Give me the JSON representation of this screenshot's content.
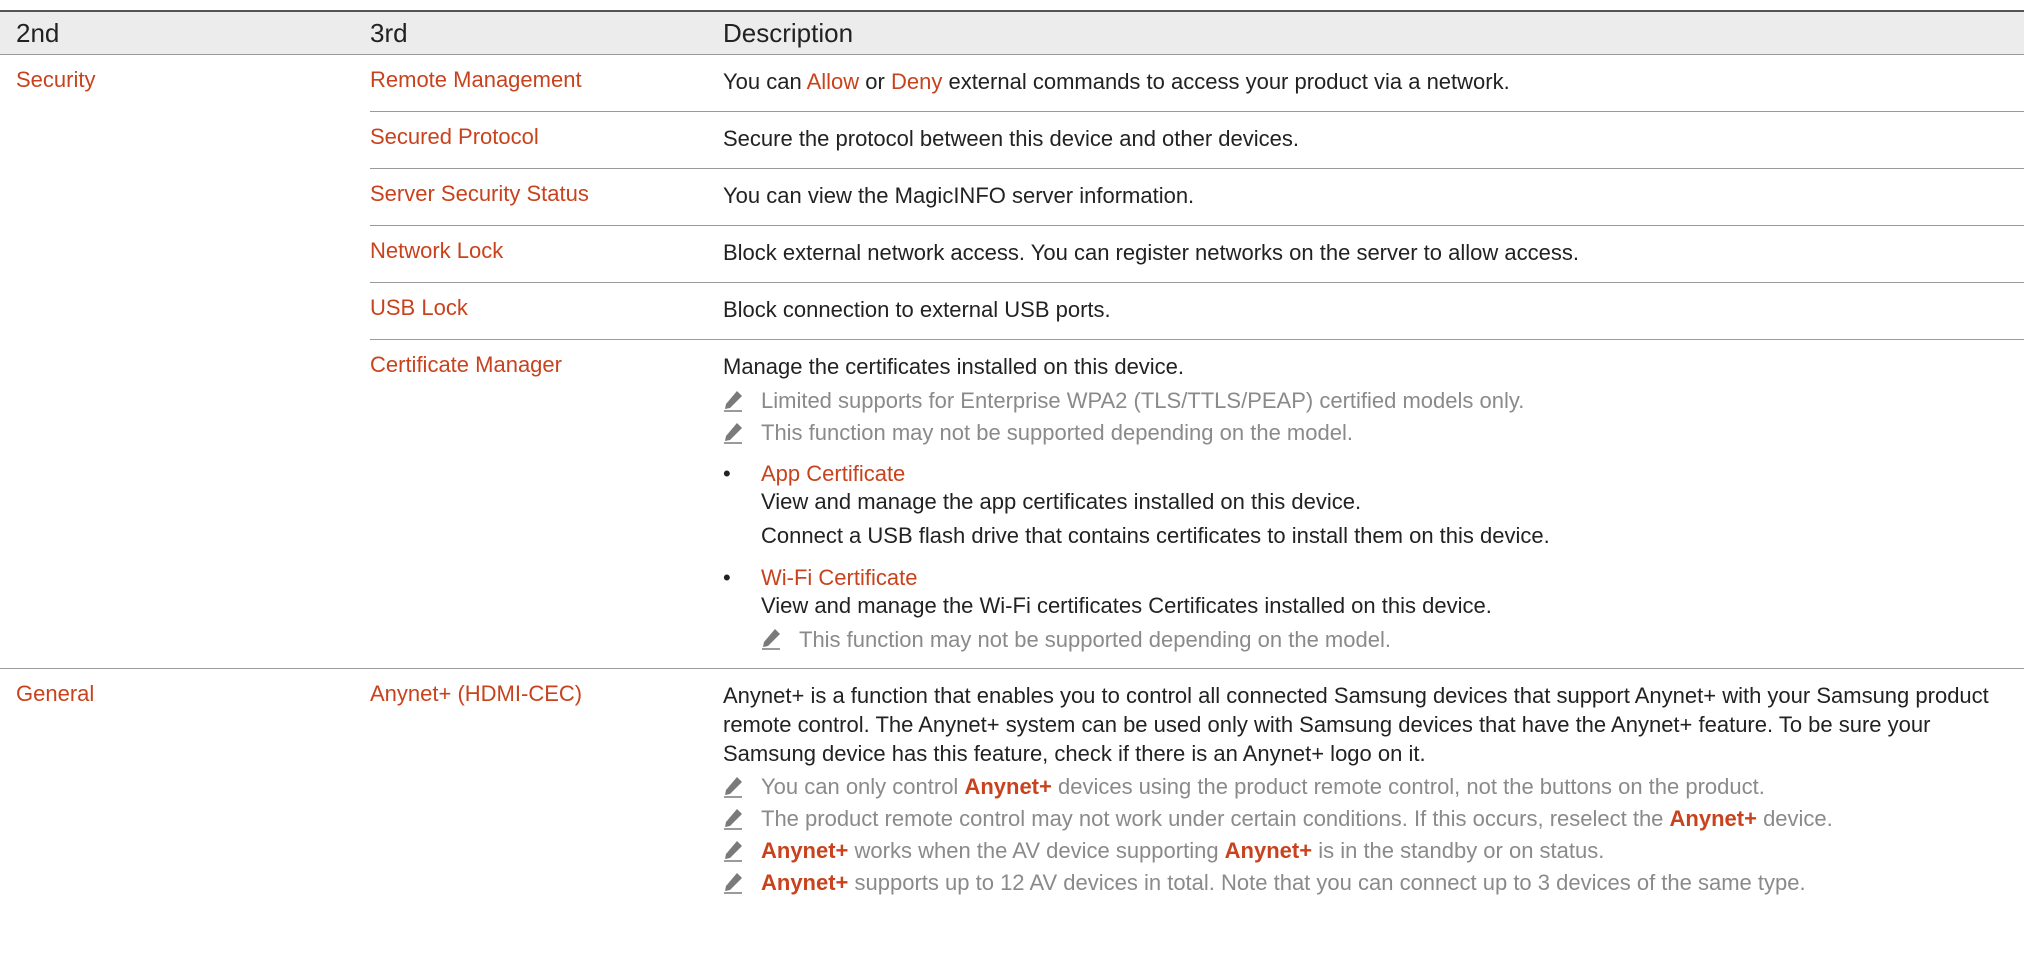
{
  "header": {
    "col1": "2nd",
    "col2": "3rd",
    "col3": "Description"
  },
  "security": {
    "label": "Security",
    "remote_management": {
      "name": "Remote Management",
      "desc_pre": "You can ",
      "allow": "Allow",
      "or": " or ",
      "deny": "Deny",
      "desc_post": " external commands to access your product via a network."
    },
    "secured_protocol": {
      "name": "Secured Protocol",
      "desc": "Secure the protocol between this device and other devices."
    },
    "server_security_status": {
      "name": "Server Security Status",
      "desc": "You can view the MagicINFO server information."
    },
    "network_lock": {
      "name": "Network Lock",
      "desc": "Block external network access. You can register networks on the server to allow access."
    },
    "usb_lock": {
      "name": "USB Lock",
      "desc": "Block connection to external USB ports."
    },
    "certificate_manager": {
      "name": "Certificate Manager",
      "desc": "Manage the certificates installed on this device.",
      "note1": "Limited supports for Enterprise WPA2 (TLS/TTLS/PEAP) certified models only.",
      "note2": "This function may not be supported depending on the model.",
      "bullet_char": "•",
      "app_cert": {
        "title": "App Certificate",
        "line1": "View and manage the app certificates installed on this device.",
        "line2": "Connect a USB flash drive that contains certificates to install them on this device."
      },
      "wifi_cert": {
        "title": "Wi-Fi Certificate",
        "line1": "View and manage the Wi-Fi certificates Certificates installed on this device.",
        "note": "This function may not be supported depending on the model."
      }
    }
  },
  "general": {
    "label": "General",
    "anynet": {
      "name": "Anynet+ (HDMI-CEC)",
      "desc": "Anynet+ is a function that enables you to control all connected Samsung devices that support Anynet+ with your Samsung product remote control. The Anynet+ system can be used only with Samsung devices that have the Anynet+ feature. To be sure your Samsung device has this feature, check if there is an Anynet+ logo on it.",
      "kw": "Anynet+",
      "n1_pre": "You can only control ",
      "n1_post": " devices using the product remote control, not the buttons on the product.",
      "n2_pre": "The product remote control may not work under certain conditions. If this occurs, reselect the ",
      "n2_post": " device.",
      "n3_mid": " works when the AV device supporting ",
      "n3_post": " is in the standby or on status.",
      "n4_post": " supports up to 12 AV devices in total. Note that you can connect up to 3 devices of the same type."
    }
  },
  "colors": {
    "accent": "#c8431d",
    "note_gray": "#8a8a8a",
    "header_bg": "#ececec"
  },
  "icons": {
    "note": "pencil-icon"
  }
}
